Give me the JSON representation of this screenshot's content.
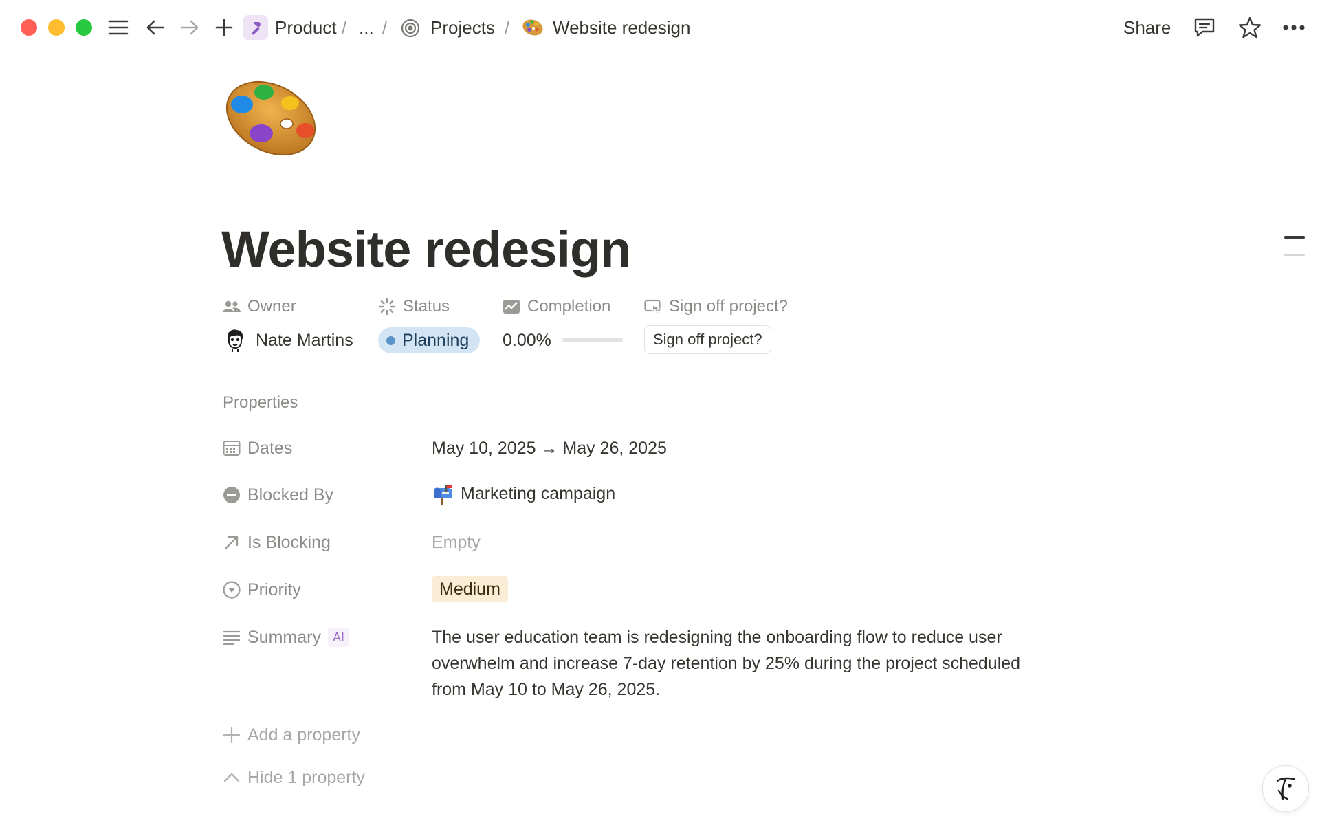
{
  "window": {
    "traffic_lights": [
      "#ff5f57",
      "#febc2e",
      "#28c840"
    ]
  },
  "breadcrumb": {
    "workspace": "Product",
    "slash1": "/",
    "ellipsis": "...",
    "slash2": "/",
    "projects": "Projects",
    "slash3": "/",
    "page": "Website redesign"
  },
  "topbar": {
    "share_label": "Share",
    "icons": [
      "sidebar-menu-icon",
      "back-arrow-icon",
      "forward-arrow-icon",
      "add-icon",
      "comment-icon",
      "star-icon",
      "more-icon"
    ]
  },
  "page": {
    "icon": "artist-palette-icon",
    "title": "Website redesign"
  },
  "header_properties": {
    "owner": {
      "label": "Owner",
      "value": "Nate Martins"
    },
    "status": {
      "label": "Status",
      "value": "Planning",
      "color": "#d3e5f4",
      "dot_color": "#5c93c8"
    },
    "completion": {
      "label": "Completion",
      "value": "0.00%",
      "progress": 0
    },
    "sign_off": {
      "label": "Sign off project?",
      "button_label": "Sign off project?"
    }
  },
  "properties": {
    "section_title": "Properties",
    "items": [
      {
        "label": "Dates",
        "icon": "calendar-icon",
        "value": "May 10, 2025 → May 26, 2025"
      },
      {
        "label": "Blocked By",
        "icon": "blocked-icon",
        "value": "Marketing campaign",
        "value_icon": "mailbox-icon"
      },
      {
        "label": "Is Blocking",
        "icon": "arrow-up-right-icon",
        "value": "Empty"
      },
      {
        "label": "Priority",
        "icon": "priority-icon",
        "value": "Medium",
        "tag_color": "#fbecd5"
      },
      {
        "label": "Summary",
        "icon": "text-lines-icon",
        "badge": "AI",
        "value_lines": [
          "The user education team is redesigning the onboarding flow to reduce user",
          "overwhelm and increase 7-day retention by 25% during the project scheduled",
          "from May 10 to May 26, 2025."
        ]
      }
    ],
    "add_label": "Add a property",
    "hide_label": "Hide 1 property"
  }
}
